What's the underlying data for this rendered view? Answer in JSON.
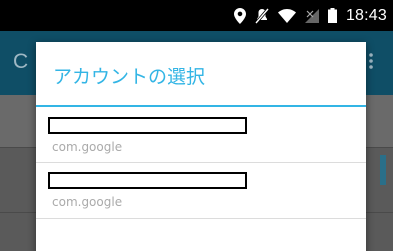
{
  "status_bar": {
    "time": "18:43",
    "icons": [
      "location-icon",
      "mute-icon",
      "wifi-icon",
      "no-signal-icon",
      "battery-icon"
    ]
  },
  "background_app": {
    "title_partial": "C"
  },
  "dialog": {
    "title": "アカウントの選択",
    "accounts": [
      {
        "name": "",
        "type": "com.google"
      },
      {
        "name": "",
        "type": "com.google"
      }
    ]
  },
  "colors": {
    "accent": "#33b5e5",
    "status_bar": "#000000",
    "app_bar": "#0f4e66",
    "secondary_text": "#aaaaaa"
  }
}
